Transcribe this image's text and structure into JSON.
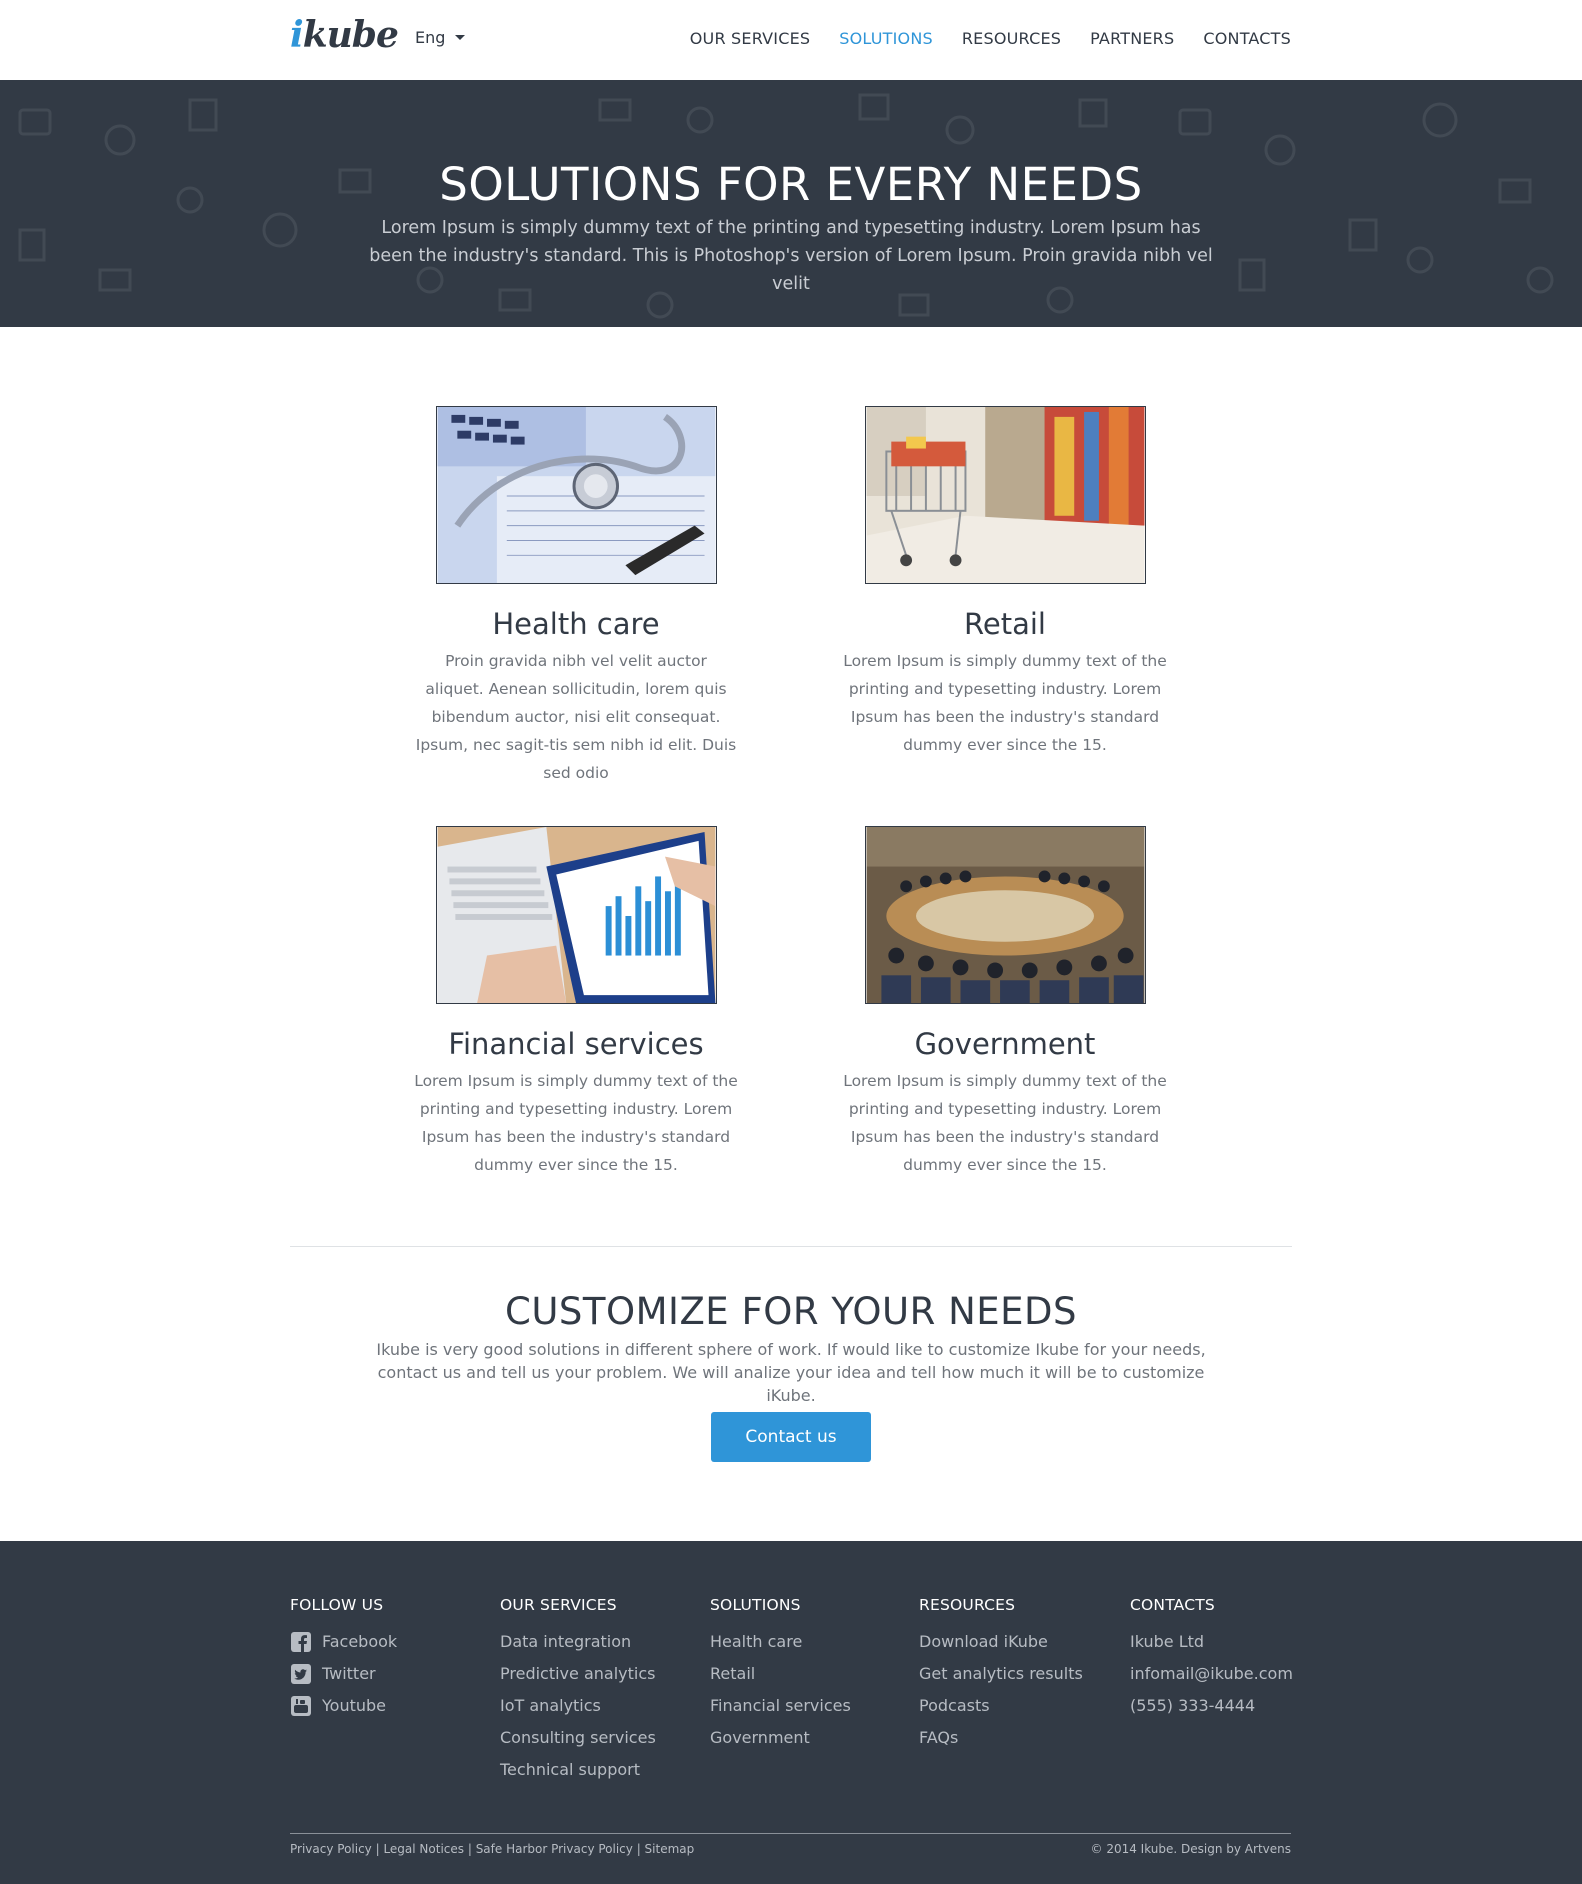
{
  "header": {
    "logo_i": "i",
    "logo_rest": "kube",
    "language": "Eng",
    "nav": [
      {
        "label": "OUR SERVICES",
        "active": false
      },
      {
        "label": "SOLUTIONS",
        "active": true
      },
      {
        "label": "RESOURCES",
        "active": false
      },
      {
        "label": "PARTNERS",
        "active": false
      },
      {
        "label": "CONTACTS",
        "active": false
      }
    ]
  },
  "hero": {
    "title": "SOLUTIONS FOR EVERY NEEDS",
    "text": "Lorem Ipsum is simply dummy text of the printing and typesetting industry. Lorem Ipsum has been the industry's standard. This is Photoshop's version  of Lorem Ipsum. Proin gravida nibh vel velit"
  },
  "solutions": [
    {
      "title": "Health care",
      "text": "Proin gravida nibh vel velit auctor aliquet. Aenean sollicitudin, lorem quis bibendum auctor, nisi elit consequat. Ipsum, nec sagit-tis sem nibh id elit. Duis sed odio",
      "image": "stethoscope-photo"
    },
    {
      "title": "Retail",
      "text": "Lorem Ipsum is simply dummy text of the printing and typesetting industry. Lorem Ipsum has been the industry's standard dummy ever since the 15.",
      "image": "shopping-cart-photo"
    },
    {
      "title": "Financial services",
      "text": "Lorem Ipsum is simply dummy text of the printing and typesetting industry. Lorem Ipsum has been the industry's standard dummy ever since the 15.",
      "image": "laptop-chart-photo"
    },
    {
      "title": "Government",
      "text": "Lorem Ipsum is simply dummy text of the printing and typesetting industry. Lorem Ipsum has been the industry's standard dummy ever since the 15.",
      "image": "council-chamber-photo"
    }
  ],
  "customize": {
    "title": "CUSTOMIZE FOR YOUR NEEDS",
    "text": "Ikube is very good solutions in different sphere of work. If would like to customize Ikube for your needs, contact us and tell us your problem. We will analize your idea and tell how much it will be to customize iKube.",
    "button": "Contact us"
  },
  "footer": {
    "follow": {
      "title": "FOLLOW US",
      "items": [
        {
          "label": "Facebook",
          "icon": "facebook-icon"
        },
        {
          "label": "Twitter",
          "icon": "twitter-icon"
        },
        {
          "label": "Youtube",
          "icon": "youtube-icon"
        }
      ]
    },
    "services": {
      "title": "OUR SERVICES",
      "items": [
        "Data integration",
        "Predictive analytics",
        "IoT analytics",
        "Consulting services",
        "Technical support"
      ]
    },
    "solutions": {
      "title": "SOLUTIONS",
      "items": [
        "Health care",
        "Retail",
        "Financial services",
        "Government"
      ]
    },
    "resources": {
      "title": "RESOURCES",
      "items": [
        "Download iKube",
        "Get analytics results",
        "Podcasts",
        "FAQs"
      ]
    },
    "contacts": {
      "title": "CONTACTS",
      "items": [
        "Ikube Ltd",
        "infomail@ikube.com",
        "(555) 333-4444"
      ]
    },
    "bottom_left": "Privacy Policy | Legal Notices | Safe Harbor Privacy Policy | Sitemap",
    "copyright": "© 2014 Ikube. Design by Artvens"
  },
  "colors": {
    "accent": "#2f95d8",
    "dark": "#323a45",
    "muted": "#6f747b"
  }
}
